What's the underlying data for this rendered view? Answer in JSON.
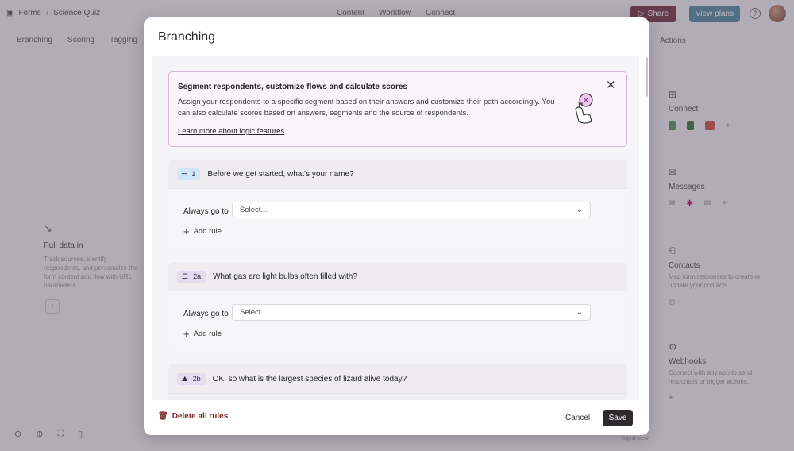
{
  "app": {
    "breadcrumb": {
      "root": "Forms",
      "current": "Science Quiz"
    },
    "top_tabs": [
      "Content",
      "Workflow",
      "Connect"
    ],
    "share_label": "Share",
    "plans_label": "View plans",
    "help": "?",
    "sub_tabs": [
      "Branching",
      "Scoring",
      "Tagging"
    ],
    "actions_label": "Actions",
    "pull": {
      "title": "Pull data in",
      "desc": "Track sources, identify respondents, and personalize the form content and flow with URL parameters"
    },
    "connect": {
      "title": "Connect"
    },
    "messages": {
      "title": "Messages"
    },
    "contacts": {
      "title": "Contacts",
      "desc": "Map form responses to create or update your contacts."
    },
    "webhooks": {
      "title": "Webhooks",
      "desc": "Connect with any app to send responses or trigger actions."
    },
    "inject_label": "Inject view"
  },
  "modal": {
    "title": "Branching",
    "banner": {
      "title": "Segment respondents, customize flows and calculate scores",
      "text": "Assign your respondents to a specific segment based on their answers and customize their path accordingly. You can also calculate scores based on answers, segments and the source of respondents.",
      "link": "Learn more about logic features"
    },
    "questions": [
      {
        "number": "1",
        "text": "Before we get started, what's your name?",
        "go_label": "Always go to",
        "select_placeholder": "Select...",
        "add_rule": "Add rule"
      },
      {
        "number": "2a",
        "text": "What gas are light bulbs often filled with?",
        "go_label": "Always go to",
        "select_placeholder": "Select...",
        "add_rule": "Add rule"
      },
      {
        "number": "2b",
        "text": "OK, so what is the largest species of lizard alive today?"
      }
    ],
    "footer": {
      "delete_label": "Delete all rules",
      "cancel_label": "Cancel",
      "save_label": "Save"
    }
  }
}
